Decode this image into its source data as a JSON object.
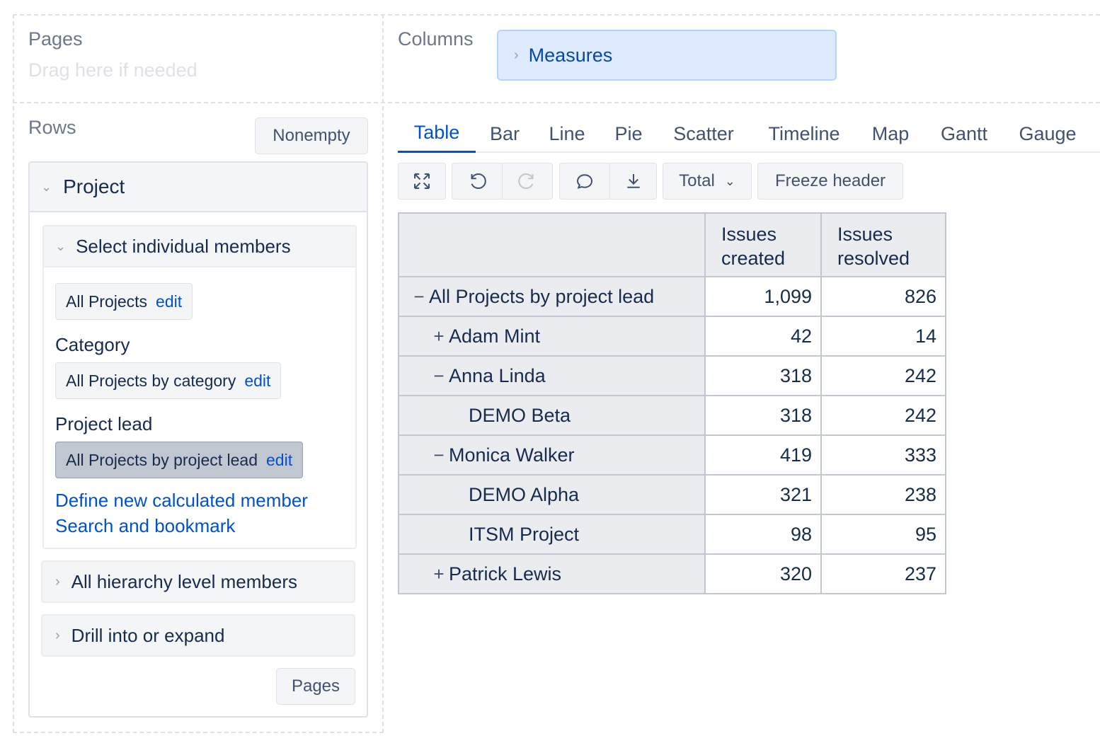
{
  "pages": {
    "title": "Pages",
    "placeholder": "Drag here if needed"
  },
  "columns": {
    "title": "Columns",
    "chip_label": "Measures"
  },
  "rows": {
    "title": "Rows",
    "nonempty_label": "Nonempty",
    "dimension": "Project",
    "select_section": "Select individual members",
    "all_projects": {
      "label": "All Projects",
      "edit": "edit"
    },
    "category": {
      "label": "Category",
      "chip": "All Projects by category",
      "edit": "edit"
    },
    "project_lead": {
      "label": "Project lead",
      "chip": "All Projects by project lead",
      "edit": "edit"
    },
    "define_link": "Define new calculated member",
    "search_link": "Search and bookmark",
    "hierarchy_section": "All hierarchy level members",
    "drill_section": "Drill into or expand",
    "pages_button": "Pages"
  },
  "tabs": [
    "Table",
    "Bar",
    "Line",
    "Pie",
    "Scatter",
    "Timeline",
    "Map",
    "Gantt",
    "Gauge"
  ],
  "active_tab": "Table",
  "toolbar": {
    "icons": [
      "fullscreen-icon",
      "undo-icon",
      "redo-icon",
      "comment-icon",
      "download-icon"
    ],
    "total_label": "Total",
    "freeze_label": "Freeze header"
  },
  "table": {
    "headers": [
      "Issues created",
      "Issues resolved"
    ],
    "header_lines": [
      [
        "Issues",
        "created"
      ],
      [
        "Issues",
        "resolved"
      ]
    ],
    "rows": [
      {
        "toggle": "−",
        "label": "All Projects by project lead",
        "created": "1,099",
        "resolved": "826"
      },
      {
        "toggle": "+",
        "label": "Adam Mint",
        "created": "42",
        "resolved": "14"
      },
      {
        "toggle": "−",
        "label": "Anna Linda",
        "created": "318",
        "resolved": "242"
      },
      {
        "toggle": "",
        "label": "DEMO Beta",
        "created": "318",
        "resolved": "242"
      },
      {
        "toggle": "−",
        "label": "Monica Walker",
        "created": "419",
        "resolved": "333"
      },
      {
        "toggle": "",
        "label": "DEMO Alpha",
        "created": "321",
        "resolved": "238"
      },
      {
        "toggle": "",
        "label": "ITSM Project",
        "created": "98",
        "resolved": "95"
      },
      {
        "toggle": "+",
        "label": "Patrick Lewis",
        "created": "320",
        "resolved": "237"
      }
    ]
  },
  "colors": {
    "link": "#0052cc",
    "chip_bg": "#deebff",
    "table_header": "#ebecf0"
  }
}
